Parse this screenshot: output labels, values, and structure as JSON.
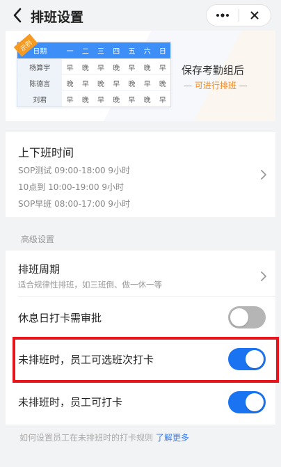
{
  "nav": {
    "title": "排班设置"
  },
  "banner": {
    "ribbon": "示例",
    "header_name": "日期",
    "days": [
      "一",
      "二",
      "三",
      "四",
      "五",
      "六",
      "日"
    ],
    "rows": [
      {
        "name": "杨算宇",
        "cells": [
          "早",
          "晚",
          "早",
          "晚",
          "早",
          "晚",
          "早"
        ]
      },
      {
        "name": "陈德言",
        "cells": [
          "晚",
          "早",
          "晚",
          "早",
          "晚",
          "早",
          "晚"
        ]
      },
      {
        "name": "刘君",
        "cells": [
          "早",
          "晚",
          "早",
          "晚",
          "早",
          "晚",
          "早"
        ]
      }
    ],
    "promo_line1": "保存考勤组后",
    "promo_line2": "— 可进行排班 —"
  },
  "shift": {
    "title": "上下班时间",
    "lines": [
      "SOP测试 09:00-18:00 9小时",
      "10点到 10:00-19:00 9小时",
      "SOP早班 08:00-17:00 9小时"
    ]
  },
  "advanced": {
    "section_label": "高级设置",
    "cycle_title": "排班周期",
    "cycle_sub": "适合规律性排班，如三班倒、做一休一等",
    "rest_day_label": "休息日打卡需审批",
    "rest_day_on": false,
    "select_shift_label": "未排班时，员工可选班次打卡",
    "select_shift_on": true,
    "can_punch_label": "未排班时，员工可打卡",
    "can_punch_on": true
  },
  "footer": {
    "text": "如何设置员工在未排班时的打卡规则 ",
    "link": "了解更多"
  },
  "colors": {
    "accent": "#1a73f0",
    "highlight": "#e8141b",
    "promo": "#f08a24"
  }
}
